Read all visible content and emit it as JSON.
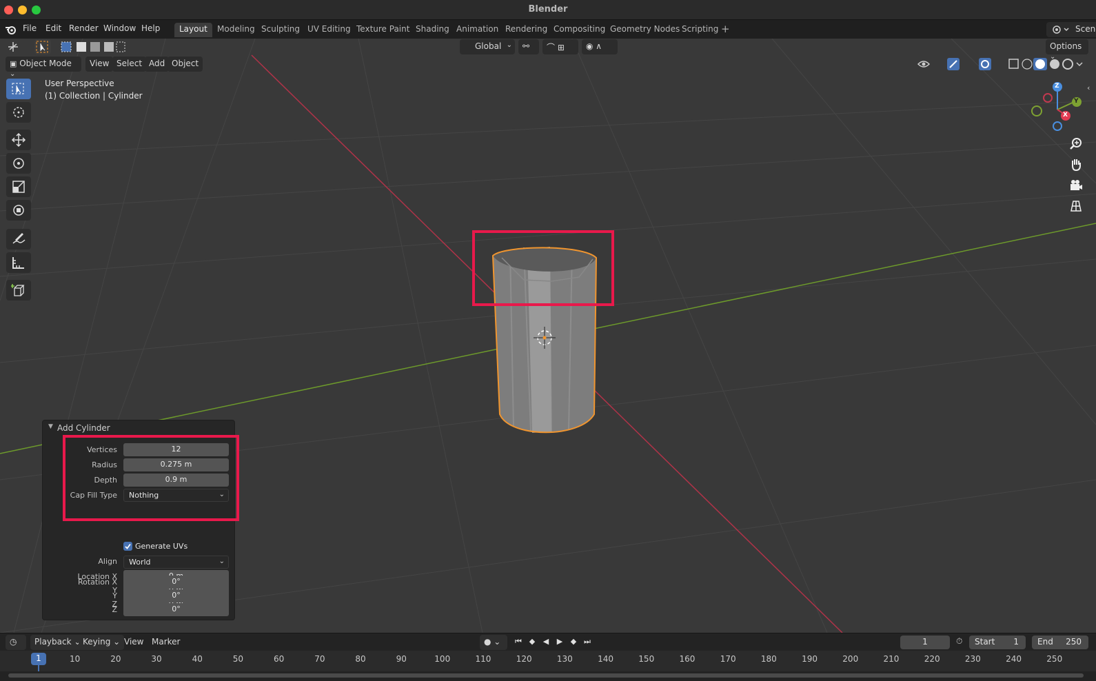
{
  "window": {
    "title": "Blender"
  },
  "menu": [
    "File",
    "Edit",
    "Render",
    "Window",
    "Help"
  ],
  "workspaces": [
    "Layout",
    "Modeling",
    "Sculpting",
    "UV Editing",
    "Texture Paint",
    "Shading",
    "Animation",
    "Rendering",
    "Compositing",
    "Geometry Nodes",
    "Scripting"
  ],
  "active_workspace": "Layout",
  "scene_label": "Scene",
  "tool_header": {
    "transform_orientation": "Global",
    "options_label": "Options"
  },
  "viewport_header": {
    "mode": "Object Mode",
    "menus": [
      "View",
      "Select",
      "Add",
      "Object"
    ]
  },
  "viewport_info": {
    "perspective": "User Perspective",
    "collection": "(1) Collection | Cylinder"
  },
  "gizmo_axes": {
    "x": "X",
    "y": "Y",
    "z": "Z"
  },
  "operator_panel": {
    "title": "Add Cylinder",
    "vertices_label": "Vertices",
    "vertices": "12",
    "radius_label": "Radius",
    "radius": "0.275 m",
    "depth_label": "Depth",
    "depth": "0.9 m",
    "cap_fill_label": "Cap Fill Type",
    "cap_fill": "Nothing",
    "generate_uvs_label": "Generate UVs",
    "generate_uvs": true,
    "align_label": "Align",
    "align": "World",
    "location_x_label": "Location X",
    "location_x": "0 m",
    "location_y_label": "Y",
    "location_y": "0 m",
    "location_z_label": "Z",
    "location_z": "0 m",
    "rotation_x_label": "Rotation X",
    "rotation_x": "0°",
    "rotation_y_label": "Y",
    "rotation_y": "0°",
    "rotation_z_label": "Z",
    "rotation_z": "0°"
  },
  "timeline": {
    "menus": [
      "Playback",
      "Keying",
      "View",
      "Marker"
    ],
    "current_frame": "1",
    "start_label": "Start",
    "start": "1",
    "end_label": "End",
    "end": "250",
    "ticks": [
      "10",
      "20",
      "30",
      "40",
      "50",
      "60",
      "70",
      "80",
      "90",
      "100",
      "110",
      "120",
      "130",
      "140",
      "150",
      "160",
      "170",
      "180",
      "190",
      "200",
      "210",
      "220",
      "230",
      "240",
      "250"
    ],
    "cursor_frame": "1"
  },
  "colors": {
    "accent": "#4772b3",
    "highlight": "#e8194b",
    "selection_outline": "#f0952f",
    "x_axis": "#c0394f",
    "y_axis": "#7ea232"
  }
}
